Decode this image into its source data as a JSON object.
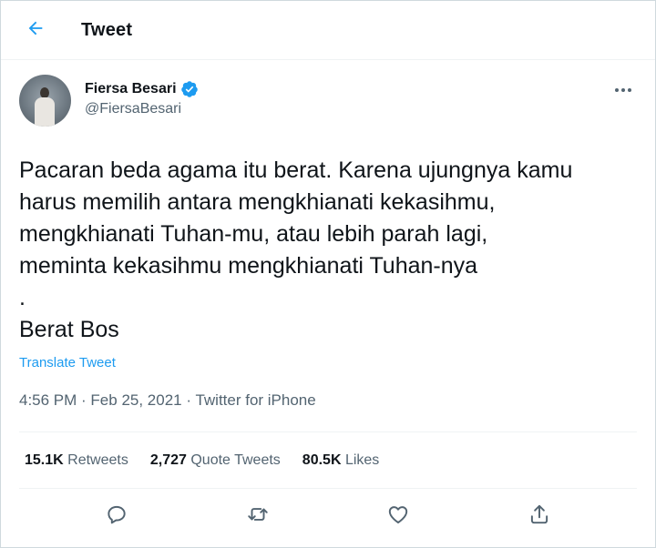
{
  "header": {
    "title": "Tweet",
    "back_icon": "arrow-left-icon"
  },
  "author": {
    "name": "Fiersa Besari",
    "handle": "@FiersaBesari",
    "verified": true,
    "more_icon": "more-horizontal-icon"
  },
  "tweet": {
    "lines": [
      "Pacaran beda agama itu berat. Karena ujungnya kamu",
      "harus memilih antara mengkhianati kekasihmu,",
      "mengkhianati Tuhan-mu, atau lebih parah lagi,",
      "meminta kekasihmu mengkhianati Tuhan-nya",
      ".",
      "Berat Bos"
    ],
    "translate_label": "Translate Tweet",
    "time": "4:56 PM",
    "date": "Feb 25, 2021",
    "source": "Twitter for iPhone",
    "separator": " · "
  },
  "stats": {
    "retweets_count": "15.1K",
    "retweets_label": "Retweets",
    "quotes_count": "2,727",
    "quotes_label": "Quote Tweets",
    "likes_count": "80.5K",
    "likes_label": "Likes"
  },
  "actions": [
    "reply-icon",
    "retweet-icon",
    "like-icon",
    "share-icon"
  ],
  "colors": {
    "accent": "#1d9bf0",
    "text": "#0f1419",
    "secondary": "#536471",
    "border": "#eff3f4"
  }
}
